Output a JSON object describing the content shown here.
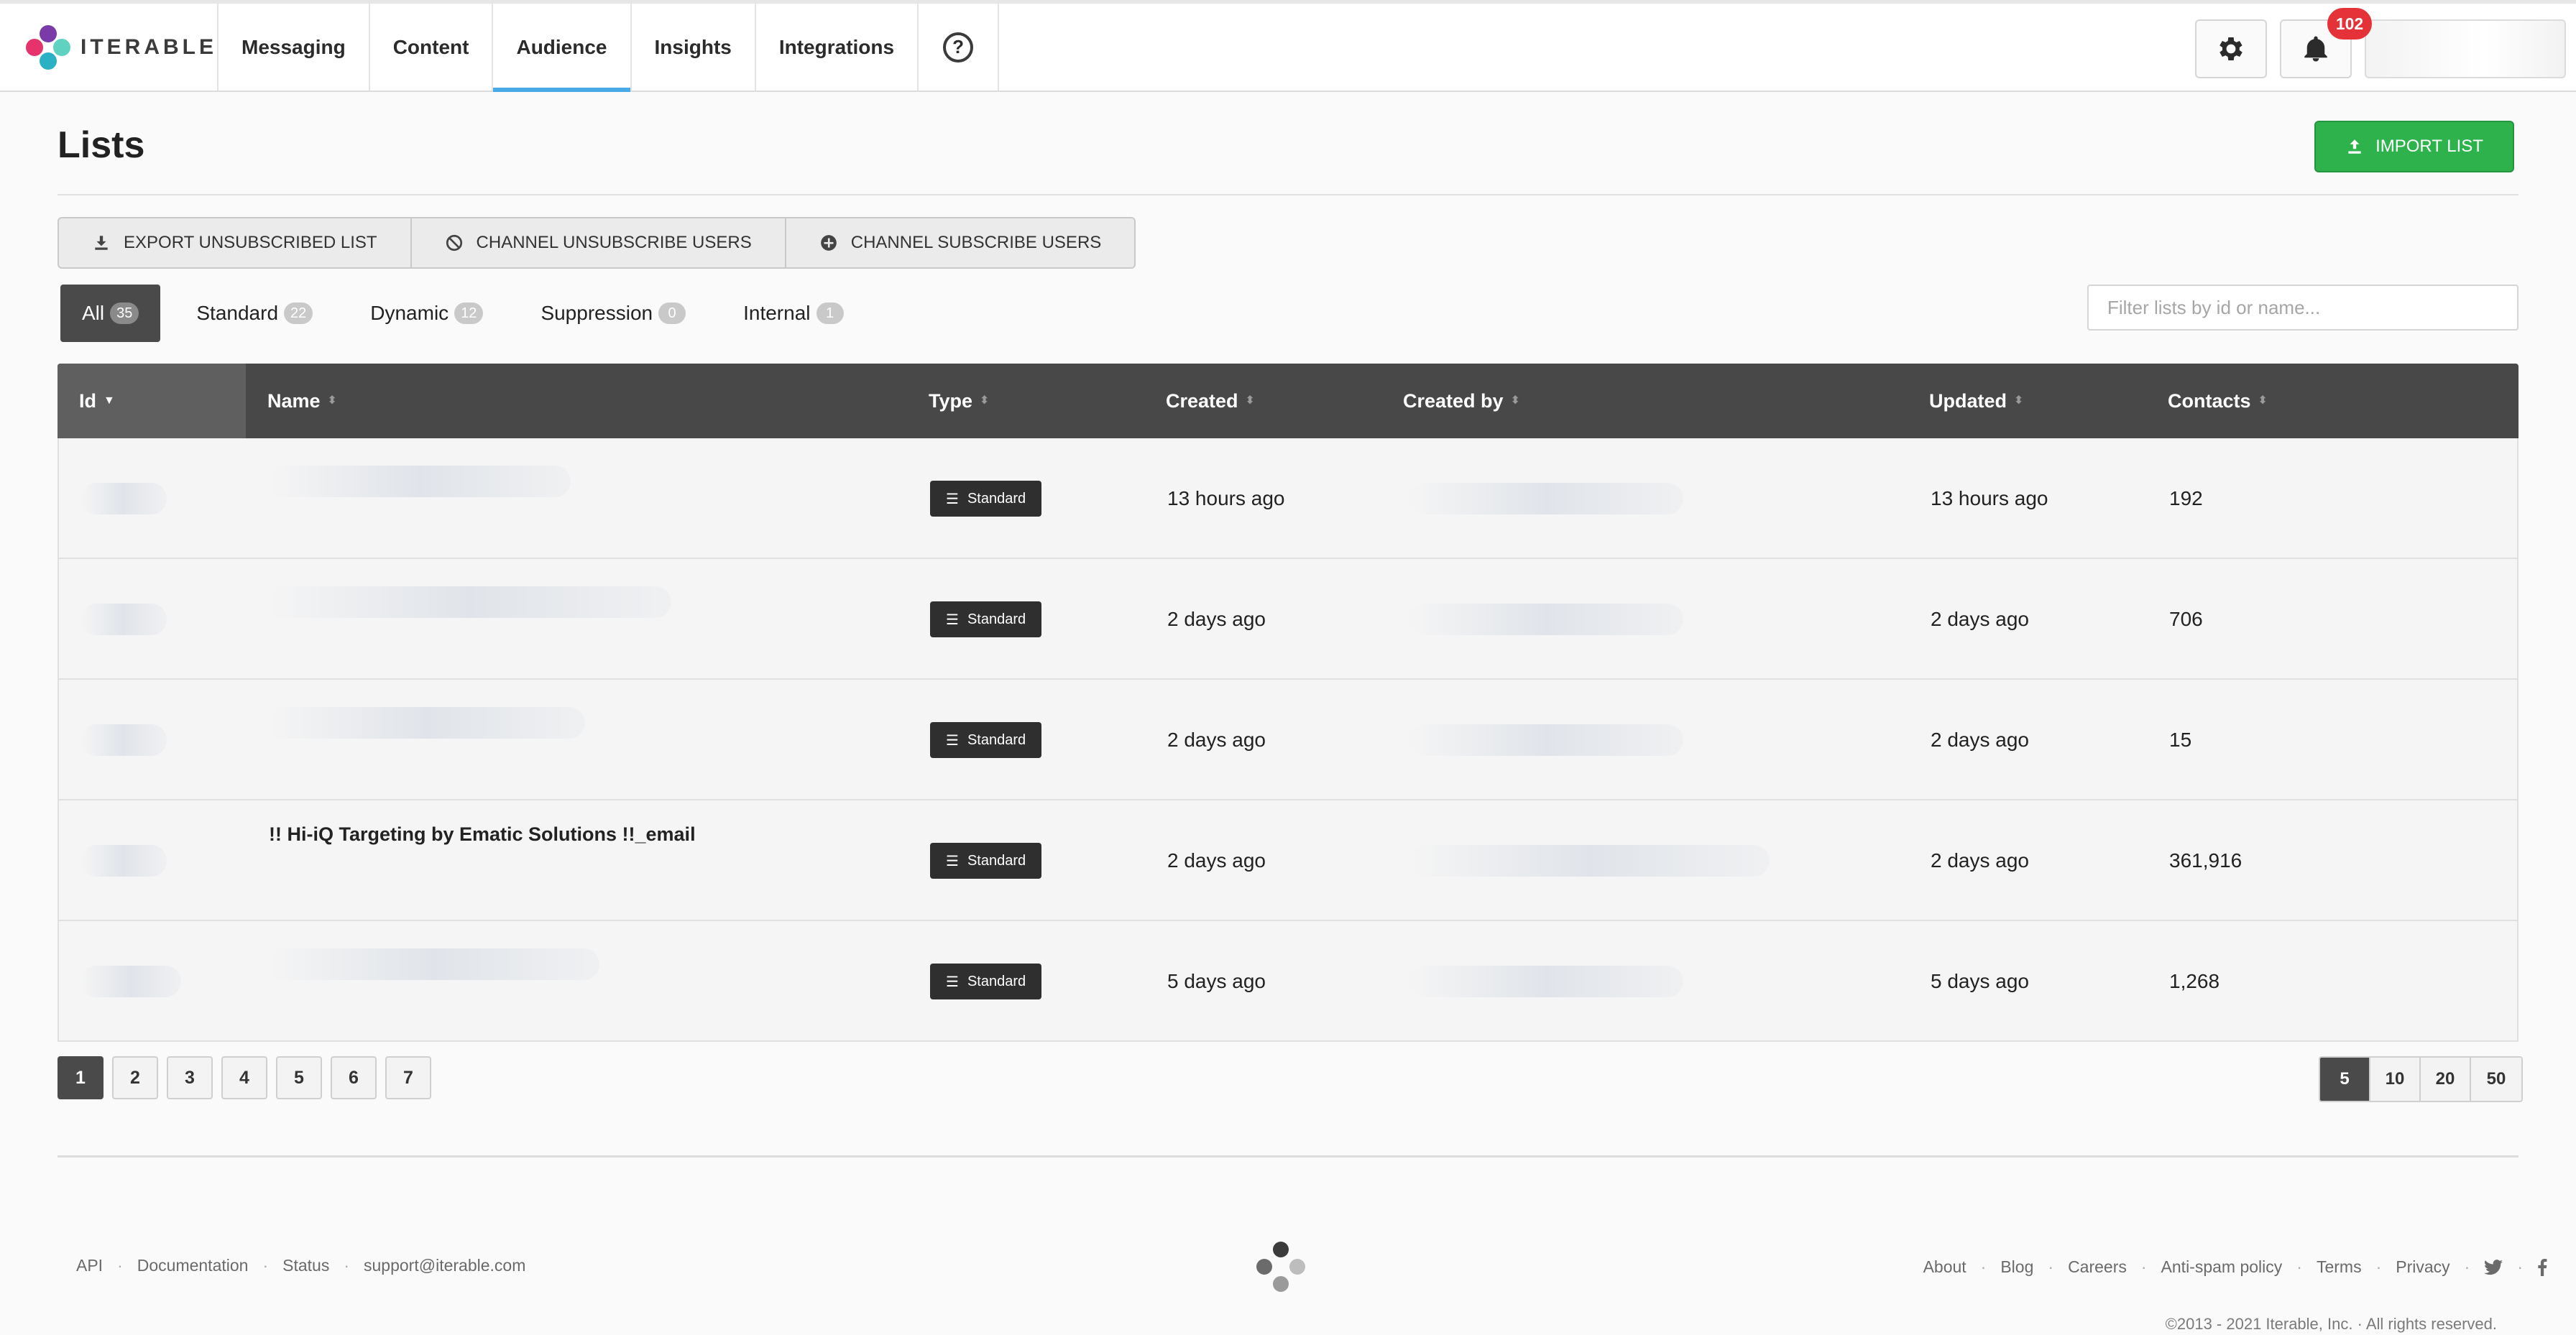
{
  "brand": {
    "name": "ITERABLE",
    "colors": [
      "#7a3aa7",
      "#e6336d",
      "#2ab2c4",
      "#5fd2c2"
    ]
  },
  "nav": {
    "items": [
      {
        "label": "Messaging",
        "active": false
      },
      {
        "label": "Content",
        "active": false
      },
      {
        "label": "Audience",
        "active": true
      },
      {
        "label": "Insights",
        "active": false
      },
      {
        "label": "Integrations",
        "active": false
      }
    ],
    "help_icon": "question-circle-icon",
    "settings_icon": "gear-icon",
    "notifications_icon": "bell-icon",
    "notifications_count": "102",
    "accent_color": "#48a9e6"
  },
  "page": {
    "title": "Lists",
    "import_label": "IMPORT LIST"
  },
  "actions": {
    "export_label": "EXPORT UNSUBSCRIBED LIST",
    "unsubscribe_label": "CHANNEL UNSUBSCRIBE USERS",
    "subscribe_label": "CHANNEL SUBSCRIBE USERS"
  },
  "tabs": [
    {
      "label": "All",
      "count": "35",
      "active": true
    },
    {
      "label": "Standard",
      "count": "22",
      "active": false
    },
    {
      "label": "Dynamic",
      "count": "12",
      "active": false
    },
    {
      "label": "Suppression",
      "count": "0",
      "active": false
    },
    {
      "label": "Internal",
      "count": "1",
      "active": false
    }
  ],
  "filter": {
    "placeholder": "Filter lists by id or name..."
  },
  "table": {
    "columns": [
      "Id",
      "Name",
      "Type",
      "Created",
      "Created by",
      "Updated",
      "Contacts"
    ],
    "rows": [
      {
        "name": "",
        "type": "Standard",
        "created": "13 hours ago",
        "updated": "13 hours ago",
        "contacts": "192"
      },
      {
        "name": "",
        "type": "Standard",
        "created": "2 days ago",
        "updated": "2 days ago",
        "contacts": "706"
      },
      {
        "name": "",
        "type": "Standard",
        "created": "2 days ago",
        "updated": "2 days ago",
        "contacts": "15"
      },
      {
        "name": "!! Hi-iQ Targeting by Ematic Solutions !!_email",
        "type": "Standard",
        "created": "2 days ago",
        "updated": "2 days ago",
        "contacts": "361,916"
      },
      {
        "name": "",
        "type": "Standard",
        "created": "5 days ago",
        "updated": "5 days ago",
        "contacts": "1,268"
      }
    ]
  },
  "pagination": {
    "pages": [
      "1",
      "2",
      "3",
      "4",
      "5",
      "6",
      "7"
    ],
    "current": "1",
    "page_sizes": [
      "5",
      "10",
      "20",
      "50"
    ],
    "current_size": "5"
  },
  "footer": {
    "left_links": [
      "API",
      "Documentation",
      "Status",
      "support@iterable.com"
    ],
    "right_links": [
      "About",
      "Blog",
      "Careers",
      "Anti-spam policy",
      "Terms",
      "Privacy"
    ],
    "social_icons": [
      "twitter-icon",
      "facebook-icon"
    ],
    "copyright": "©2013 - 2021 Iterable, Inc. · All rights reserved."
  }
}
